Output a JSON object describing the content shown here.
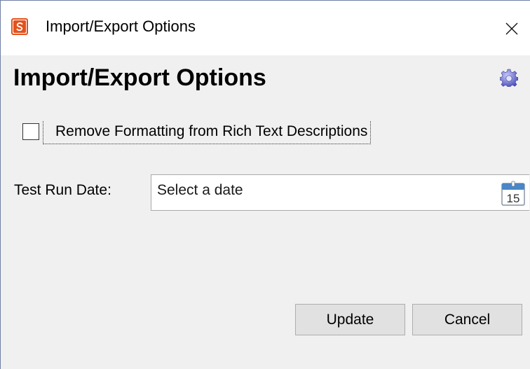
{
  "window": {
    "title": "Import/Export Options",
    "close_glyph": "close-icon",
    "app_icon": "app-s-icon",
    "accent_color": "#e2521e"
  },
  "header": {
    "title": "Import/Export Options",
    "settings_icon": "gear-icon"
  },
  "options": {
    "remove_formatting": {
      "label": "Remove Formatting from Rich Text Descriptions",
      "checked": false
    },
    "test_run_date": {
      "label": "Test Run Date:",
      "value": "",
      "placeholder": "Select a date",
      "calendar_icon": "calendar-icon",
      "calendar_day": "15"
    }
  },
  "buttons": {
    "update_label": "Update",
    "cancel_label": "Cancel"
  }
}
